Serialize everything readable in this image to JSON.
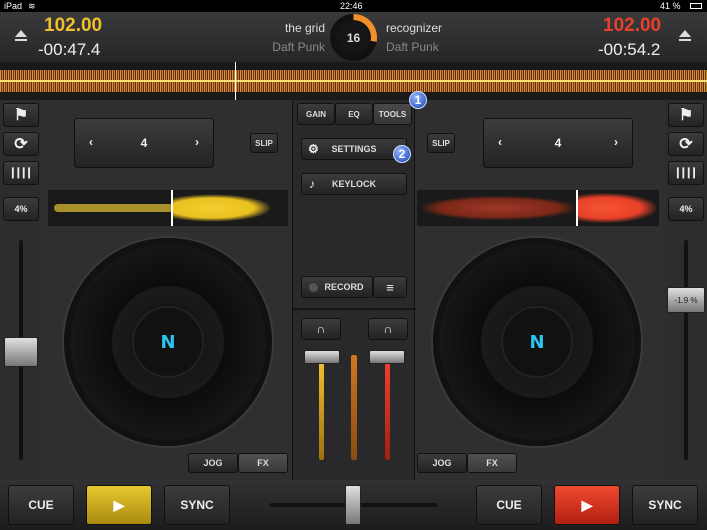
{
  "status": {
    "device": "iPad",
    "time": "22:46",
    "battery": "41 %"
  },
  "left_deck": {
    "bpm": "102.00",
    "time": "-00:47.4",
    "title": "the grid",
    "artist": "Daft Punk",
    "loop_size": "4",
    "slip": "SLIP",
    "pitch": "4%",
    "jog": "JOG",
    "fx": "FX",
    "cue": "CUE",
    "sync": "SYNC",
    "play": "▶",
    "color": "#f0c02a"
  },
  "right_deck": {
    "bpm": "102.00",
    "time": "-00:54.2",
    "title": "recognizer",
    "artist": "Daft Punk",
    "loop_size": "4",
    "slip": "SLIP",
    "pitch": "4%",
    "pitch_value": "-1.9 %",
    "jog": "JOG",
    "fx": "FX",
    "cue": "CUE",
    "sync": "SYNC",
    "play": "▶",
    "color": "#e8402a"
  },
  "center": {
    "beat_counter": "16",
    "tabs": [
      "GAIN",
      "EQ",
      "TOOLS"
    ],
    "settings": "SETTINGS",
    "keylock": "KEYLOCK",
    "record": "RECORD"
  },
  "annotations": [
    "1",
    "2"
  ],
  "icons": {
    "eject": "eject-icon",
    "flag": "flag-icon",
    "loop": "loop-icon",
    "grid": "grid-icon",
    "gear": "gear-icon",
    "note": "note-icon",
    "headphones": "headphones-icon",
    "menu": "menu-icon"
  }
}
